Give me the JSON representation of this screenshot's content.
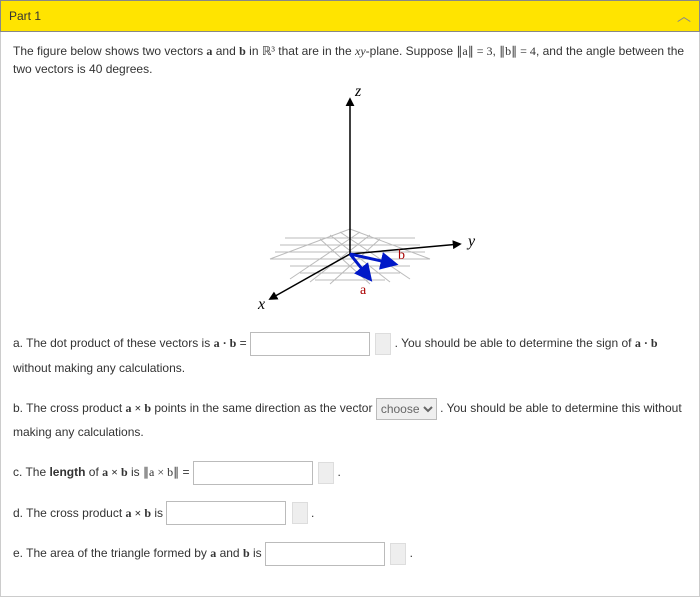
{
  "header": {
    "title": "Part 1"
  },
  "problem": {
    "pre": "The figure below shows two vectors ",
    "a": "a",
    "and": " and ",
    "b": "b",
    "in": " in ",
    "space": "ℝ³",
    "plane_pre": " that are in the ",
    "plane_var": "xy",
    "plane_post": "-plane. Suppose ",
    "norm_a": "∥a∥ = 3",
    "comma": ", ",
    "norm_b": "∥b∥ = 4",
    "angle_text": ", and the angle between the two vectors is ",
    "angle_val": "40 degrees."
  },
  "figure": {
    "axis_x": "x",
    "axis_y": "y",
    "axis_z": "z",
    "vec_a": "a",
    "vec_b": "b"
  },
  "questions": {
    "a": {
      "pre": "a. The dot product of these vectors is ",
      "expr": "a · b",
      "eq": " = ",
      "post": " . You should be able to determine the sign of ",
      "expr2": "a · b",
      "tail": " without making any calculations."
    },
    "b": {
      "pre": "b. The cross product ",
      "expr": "a × b",
      "mid": " points in the same direction as the vector ",
      "choose": "choose",
      "post": ". You should be able to determine this without making any calculations."
    },
    "c": {
      "pre": "c. The ",
      "len": "length",
      "of": " of ",
      "expr1": "a × b",
      "is": " is ",
      "expr2": "∥a × b∥",
      "eq": " = ",
      "period": " ."
    },
    "d": {
      "pre": "d. The cross product ",
      "expr": "a × b",
      "is": " is ",
      "period": " ."
    },
    "e": {
      "pre": "e. The area of the triangle formed by ",
      "a": "a",
      "and": " and ",
      "b": "b",
      "is": " is ",
      "period": " ."
    }
  }
}
